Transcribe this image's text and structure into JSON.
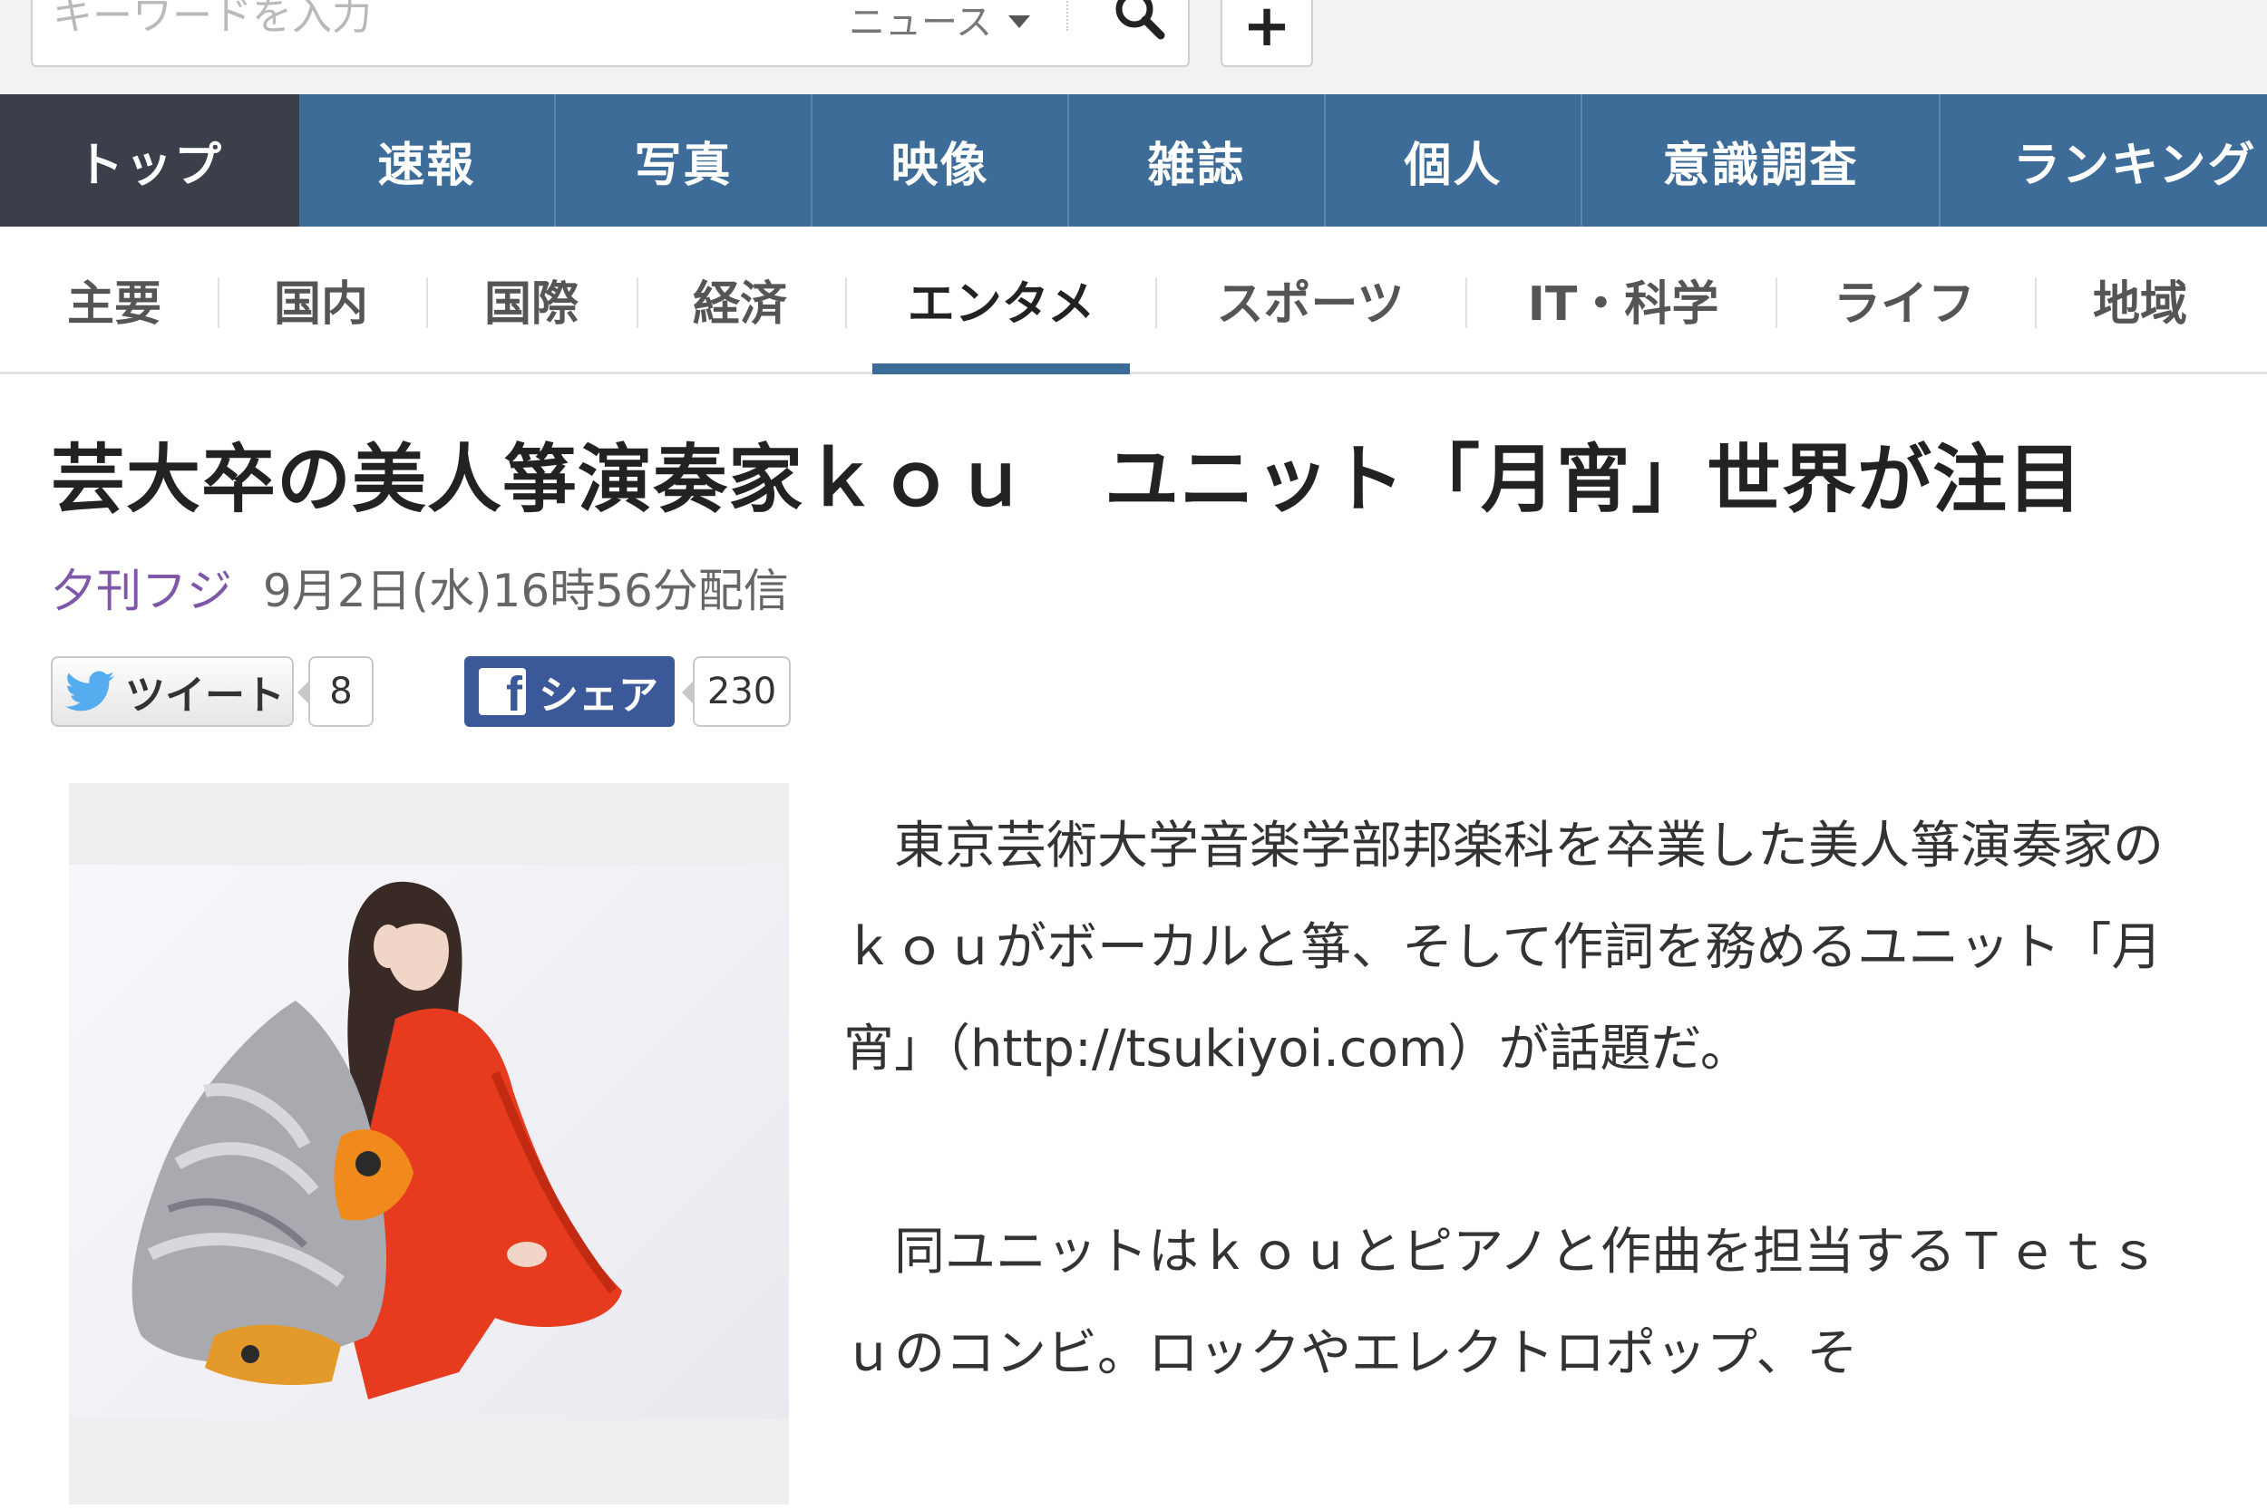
{
  "search": {
    "placeholder": "キーワードを入力",
    "category": "ニュース",
    "add_label": "+"
  },
  "main_nav": [
    {
      "label": "トップ",
      "active": true
    },
    {
      "label": "速報"
    },
    {
      "label": "写真"
    },
    {
      "label": "映像"
    },
    {
      "label": "雑誌"
    },
    {
      "label": "個人"
    },
    {
      "label": "意識調査"
    },
    {
      "label": "ランキング"
    }
  ],
  "sub_nav": [
    {
      "label": "主要"
    },
    {
      "label": "国内"
    },
    {
      "label": "国際"
    },
    {
      "label": "経済"
    },
    {
      "label": "エンタメ",
      "active": true
    },
    {
      "label": "スポーツ"
    },
    {
      "label": "IT・科学"
    },
    {
      "label": "ライフ"
    },
    {
      "label": "地域"
    }
  ],
  "article": {
    "title": "芸大卒の美人箏演奏家ｋｏｕ　ユニット「月宵」世界が注目",
    "source": "夕刊フジ",
    "date": "9月2日(水)16時56分配信",
    "paragraphs": [
      "東京芸術大学音楽学部邦楽科を卒業した美人箏演奏家のｋｏｕがボーカルと箏、そして作詞を務めるユニット「月宵」（http://tsukiyoi.com）が話題だ。",
      "同ユニットはｋｏｕとピアノと作曲を担当するＴｅｔｓｕのコンビ。ロックやエレクトロポップ、そ"
    ]
  },
  "share": {
    "tweet_label": "ツイート",
    "tweet_count": "8",
    "share_label": "シェア",
    "share_count": "230"
  },
  "colors": {
    "nav_blue": "#3d6c99",
    "nav_active": "#3a3f4a",
    "source_purple": "#7e57a8",
    "facebook": "#3b5998",
    "twitter": "#55acee"
  }
}
